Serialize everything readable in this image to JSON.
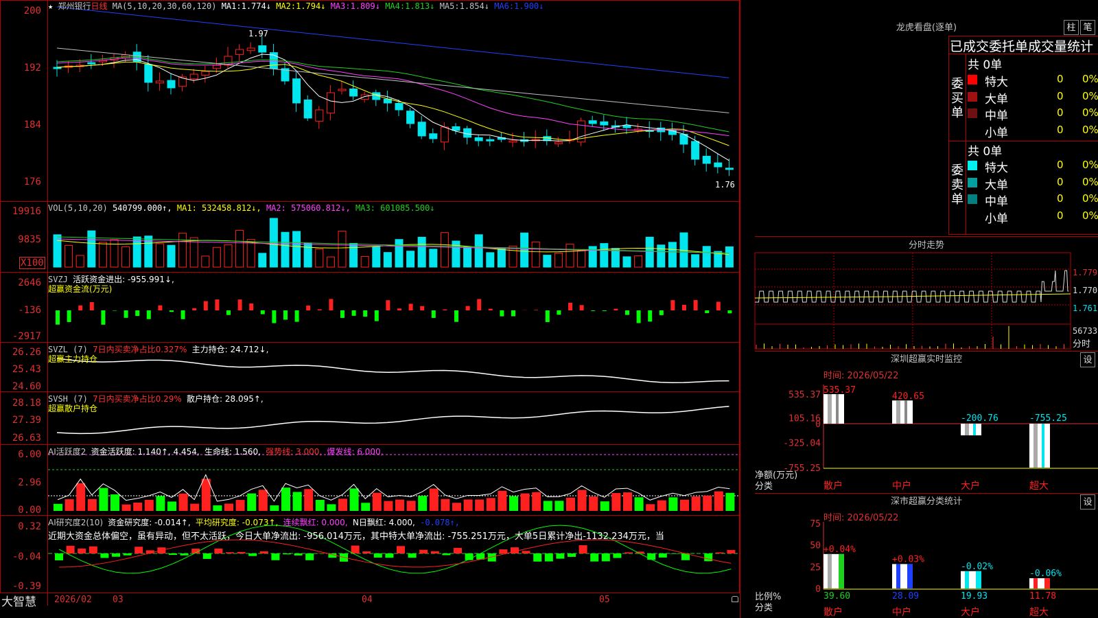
{
  "colors": {
    "up": "#ff2020",
    "down": "#00e5ee",
    "ma1": "#ffffff",
    "ma2": "#ffff00",
    "ma3": "#ff40ff",
    "ma4": "#20d020",
    "ma5": "#c0c0c0",
    "ma6": "#2040ff",
    "grid": "#b30000",
    "axis": "#e03030"
  },
  "main": {
    "star": "★",
    "stock": "郑州银行",
    "period": "日线",
    "ma_title": "MA(5,10,20,30,60,120)",
    "ma_values": [
      {
        "name": "MA1:",
        "value": "1.774↓"
      },
      {
        "name": "MA2:",
        "value": "1.794↓"
      },
      {
        "name": "MA3:",
        "value": "1.809↓"
      },
      {
        "name": "MA4:",
        "value": "1.813↓"
      },
      {
        "name": "MA5:",
        "value": "1.854↓"
      },
      {
        "name": "MA6:",
        "value": "1.900↓"
      }
    ],
    "y_ticks": [
      "200",
      "192",
      "184",
      "176"
    ],
    "high_label": "1.97",
    "low_label": "1.76"
  },
  "vol": {
    "title": "VOL(5,10,20)",
    "value": "540799.000↑",
    "ma1": "MA1: 532458.812↓",
    "ma2": "MA2: 575060.812↓",
    "ma3": "MA3: 601085.500↓",
    "y_ticks": [
      "19916",
      "9835"
    ],
    "unit": "X100"
  },
  "svzj": {
    "title": "SVZJ",
    "label": "活跃资金进出: -955.991↓,",
    "sub": "超赢资金流(万元)",
    "y_ticks": [
      "2646",
      "-136",
      "-2917"
    ]
  },
  "svzl": {
    "title": "SVZL (7)",
    "ratio": "7日内买卖净占比0.327%",
    "hold": "主力持仓: 24.712↓,",
    "sub": "超赢主力持仓",
    "y_ticks": [
      "26.26",
      "25.43",
      "24.60"
    ]
  },
  "svsh": {
    "title": "SVSH (7)",
    "ratio": "7日内买卖净占比0.29%",
    "hold": "散户持仓: 28.095↑,",
    "sub": "超赢散户持仓",
    "y_ticks": [
      "28.18",
      "27.39",
      "26.63"
    ]
  },
  "ai1": {
    "title": "AI活跃度2",
    "a": "资金活跃度: 1.140↑, 4.454,",
    "b": "生命线: 1.560,",
    "c": "强势线: 3.000,",
    "d": "爆发线: 6.000,",
    "y_ticks": [
      "6.00",
      "2.96",
      "0.00"
    ]
  },
  "ai2": {
    "title": "AI研究度2(10)",
    "a": "资金研究度: -0.014↑,",
    "b": "平均研究度: -0.073↑,",
    "c": "连续飘红: 0.000,",
    "d": "N日飘红: 4.000,",
    "e": "-0.078↑,",
    "comment": "近期大资金总体偏空，虽有异动，但不太活跃，今日大单净流出: -956.014万元，其中特大单净流出: -755.251万元，大单5日累计净出-1132.234万元，当",
    "y_ticks": [
      "0.32",
      "-0.04",
      "-0.39"
    ]
  },
  "bottom": {
    "brand": "大智慧",
    "dates": [
      "2026/02",
      "03",
      "04",
      "05"
    ]
  },
  "lhb": {
    "title": "龙虎看盘(逐单)",
    "btn1": "柱",
    "btn2": "笔",
    "header": "已成交委托单成交量统计",
    "buy_side": "委买单",
    "sell_side": "委卖单",
    "buy_total": "共 0单",
    "sell_total": "共 0单",
    "buy_rows": [
      {
        "label": "特大",
        "color": "#ff0000",
        "n": "0",
        "p": "0%"
      },
      {
        "label": "大单",
        "color": "#a01010",
        "n": "0",
        "p": "0%"
      },
      {
        "label": "中单",
        "color": "#701010",
        "n": "0",
        "p": "0%"
      },
      {
        "label": "小单",
        "color": "",
        "n": "0",
        "p": "0%"
      }
    ],
    "sell_rows": [
      {
        "label": "特大",
        "color": "#00f0f0",
        "n": "0",
        "p": "0%"
      },
      {
        "label": "大单",
        "color": "#00a0a0",
        "n": "0",
        "p": "0%"
      },
      {
        "label": "中单",
        "color": "#008080",
        "n": "0",
        "p": "0%"
      },
      {
        "label": "小单",
        "color": "",
        "n": "0",
        "p": "0%"
      }
    ]
  },
  "intraday": {
    "title": "分时走势",
    "y_labels": [
      "1.779",
      "1.770",
      "1.761"
    ],
    "vol_label": "56733",
    "vol_unit": "分时"
  },
  "monitor": {
    "title": "深圳超赢实时监控",
    "btn": "设",
    "time": "时间: 2026/05/22",
    "y_ticks": [
      "535.37",
      "105.16",
      "0",
      "-325.04",
      "-755.25"
    ],
    "y_label": "净额(万元)",
    "cat_label": "分类",
    "categories": [
      "散户",
      "中户",
      "大户",
      "超大"
    ],
    "values": [
      535.37,
      420.65,
      -200.76,
      -755.25
    ],
    "value_labels": [
      "535.37",
      "420.65",
      "-200.76",
      "-755.25"
    ]
  },
  "stats": {
    "title": "深市超赢分类统计",
    "btn": "设",
    "time": "时间: 2026/05/22",
    "y_ticks": [
      "75",
      "50",
      "25",
      "0"
    ],
    "y_label": "比例%",
    "cat_label": "分类",
    "categories": [
      "散户",
      "中户",
      "大户",
      "超大"
    ],
    "values": [
      39.6,
      28.09,
      19.93,
      11.78
    ],
    "value_labels": [
      "39.60",
      "28.09",
      "19.93",
      "11.78"
    ],
    "change_labels": [
      "+0.04%",
      "+0.03%",
      "-0.02%",
      "-0.06%"
    ]
  }
}
